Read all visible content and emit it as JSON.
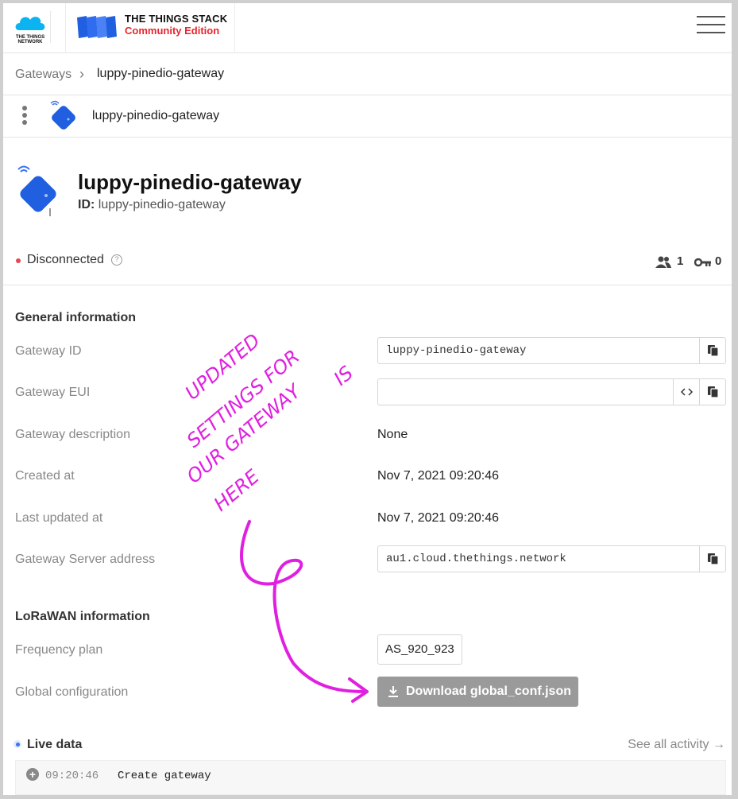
{
  "header": {
    "ttn_logo_text": "THE THINGS NETWORK",
    "stack_title": "THE THINGS STACK",
    "stack_subtitle": "Community Edition",
    "menu_icon": "hamburger-icon"
  },
  "breadcrumb": {
    "items": [
      "Gateways",
      "luppy-pinedio-gateway"
    ],
    "separator": "›"
  },
  "subheader": {
    "title": "luppy-pinedio-gateway"
  },
  "gateway": {
    "name": "luppy-pinedio-gateway",
    "id_label": "ID:",
    "id": "luppy-pinedio-gateway",
    "status": "Disconnected",
    "collaborators": "1",
    "api_keys": "0"
  },
  "general": {
    "title": "General information",
    "fields": [
      {
        "label": "Gateway ID",
        "value": "luppy-pinedio-gateway"
      },
      {
        "label": "Gateway EUI",
        "value": ""
      },
      {
        "label": "Gateway description",
        "value": "None"
      },
      {
        "label": "Created at",
        "value": "Nov 7, 2021 09:20:46"
      },
      {
        "label": "Last updated at",
        "value": "Nov 7, 2021 09:20:46"
      },
      {
        "label": "Gateway Server address",
        "value": "au1.cloud.thethings.network"
      }
    ]
  },
  "lorawan": {
    "title": "LoRaWAN information",
    "frequency_label": "Frequency plan",
    "frequency_value": "AS_920_923",
    "global_conf_label": "Global configuration",
    "download_label": "Download global_conf.json"
  },
  "live": {
    "title": "Live data",
    "see_all": "See all activity →",
    "events": [
      {
        "time": "09:20:46",
        "name": "Create gateway"
      }
    ]
  },
  "annotation": {
    "lines": [
      "UPDATED",
      "SETTINGS FOR",
      "IS",
      "OUR GATEWAY",
      "HERE"
    ],
    "color": "#e020e0"
  },
  "colors": {
    "brand_red": "#e8252d",
    "brand_blue": "#1f5fe0",
    "status_red": "#e5484d",
    "live_blue": "#3b73f0",
    "button_gray": "#9a9a9a"
  }
}
